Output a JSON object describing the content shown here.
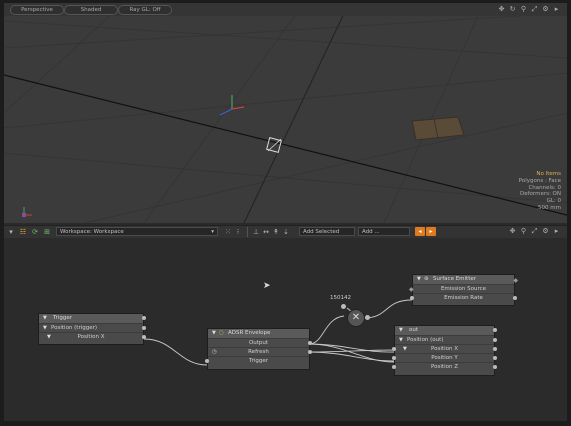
{
  "viewport": {
    "pills": [
      "Perspective",
      "Shaded",
      "Ray GL: Off"
    ],
    "icons": [
      "move-icon",
      "rotate-icon",
      "zoom-icon",
      "maximize-icon",
      "gear-icon",
      "arrow-right-icon"
    ],
    "info": [
      "No Items",
      "Polygons : Face",
      "Channels: 0",
      "Deformers: ON",
      "GL: 0",
      "500 mm"
    ]
  },
  "toolbar": {
    "workspace": "Workspace: Workspace",
    "add_selected": "Add Selected",
    "add": "Add ...",
    "accent": "#e07a20"
  },
  "graph": {
    "value_label": "150142",
    "trigger_node": {
      "title": "Trigger",
      "rows": [
        "Position (trigger)",
        "Position X"
      ]
    },
    "envelope_node": {
      "title": "ADSR Envelope",
      "rows": [
        "Output",
        "Refresh",
        "Trigger"
      ]
    },
    "surface_node": {
      "title": "Surface Emitter",
      "rows": [
        "Emission Source",
        "Emission Rate"
      ]
    },
    "out_node": {
      "title": "out",
      "rows": [
        "Position (out)",
        "Position X",
        "Position Y",
        "Position Z"
      ]
    }
  }
}
